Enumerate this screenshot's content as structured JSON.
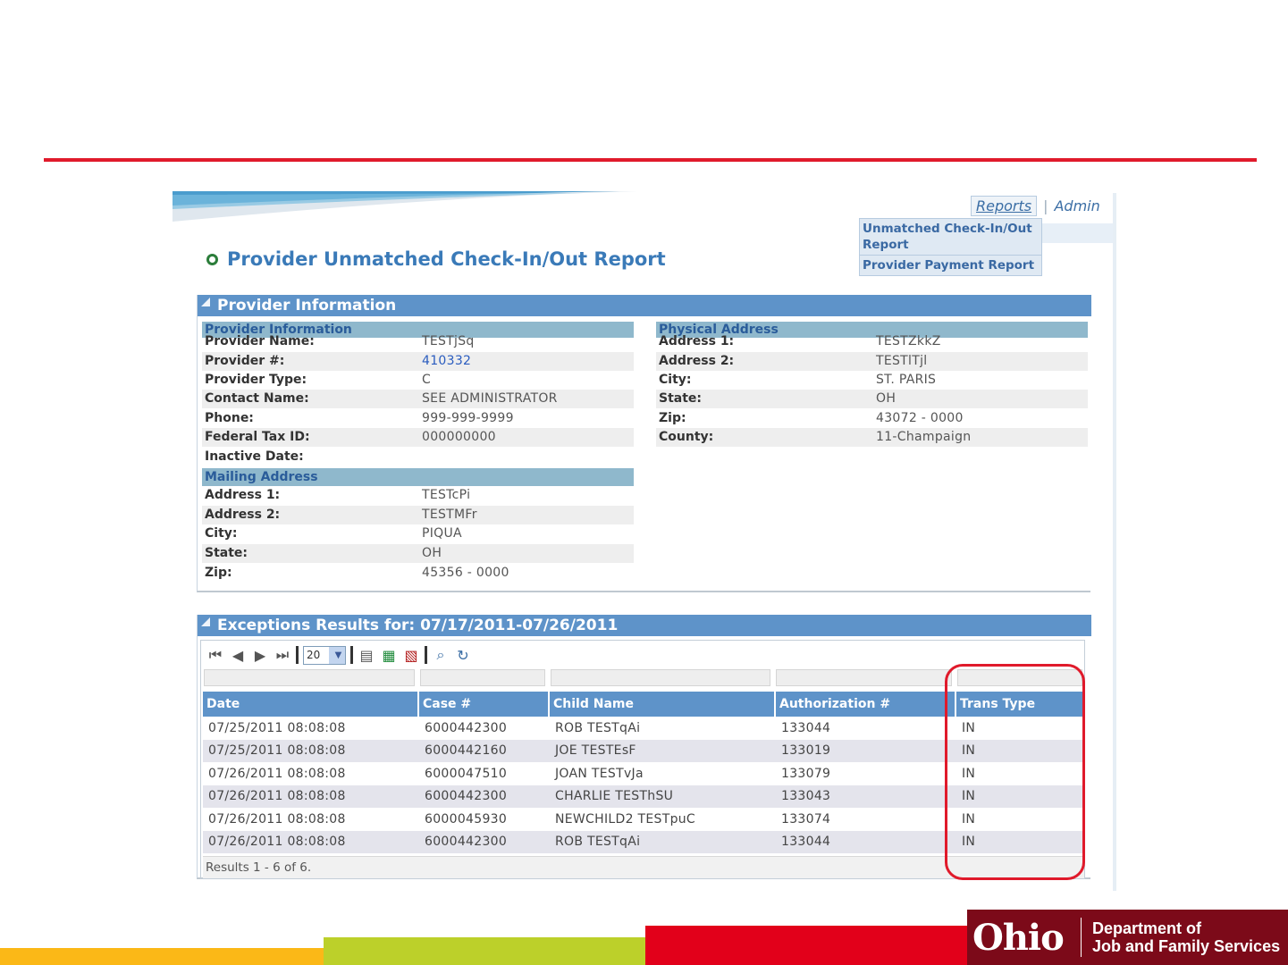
{
  "colors": {
    "accent_red": "#e01a2b",
    "header_blue": "#5e93c9",
    "title_blue": "#3a7ab8",
    "ohio_maroon": "#7c0a19"
  },
  "nav": {
    "reports": "Reports",
    "separator": "|",
    "admin": "Admin"
  },
  "reports_menu": {
    "item1": "Unmatched Check-In/Out Report",
    "item2": "Provider Payment Report"
  },
  "page_title": "Provider Unmatched Check-In/Out Report",
  "provider_panel": {
    "header": "Provider Information",
    "provider_info_header": "Provider Information",
    "provider_info": [
      {
        "label": "Provider Name:",
        "value": "TESTjSq"
      },
      {
        "label": "Provider #:",
        "value": "410332"
      },
      {
        "label": "Provider Type:",
        "value": "C"
      },
      {
        "label": "Contact Name:",
        "value": "SEE ADMINISTRATOR"
      },
      {
        "label": "Phone:",
        "value": "999-999-9999"
      },
      {
        "label": "Federal Tax ID:",
        "value": "000000000"
      },
      {
        "label": "Inactive Date:",
        "value": ""
      }
    ],
    "mailing_header": "Mailing Address",
    "mailing": [
      {
        "label": "Address 1:",
        "value": "TESTcPi"
      },
      {
        "label": "Address 2:",
        "value": "TESTMFr"
      },
      {
        "label": "City:",
        "value": "PIQUA"
      },
      {
        "label": "State:",
        "value": "OH"
      },
      {
        "label": "Zip:",
        "value": "45356 - 0000"
      }
    ],
    "physical_header": "Physical Address",
    "physical": [
      {
        "label": "Address 1:",
        "value": "TESTZkkZ"
      },
      {
        "label": "Address 2:",
        "value": "TESTlTjl"
      },
      {
        "label": "City:",
        "value": "ST. PARIS"
      },
      {
        "label": "State:",
        "value": "OH"
      },
      {
        "label": "Zip:",
        "value": "43072 - 0000"
      },
      {
        "label": "County:",
        "value": "11-Champaign"
      }
    ]
  },
  "exceptions": {
    "header": "Exceptions Results for: 07/17/2011-07/26/2011",
    "page_size": "20",
    "columns": [
      "Date",
      "Case #",
      "Child Name",
      "Authorization #",
      "Trans Type"
    ],
    "rows": [
      [
        "07/25/2011 08:08:08",
        "6000442300",
        "ROB TESTqAi",
        "133044",
        "IN"
      ],
      [
        "07/25/2011 08:08:08",
        "6000442160",
        "JOE TESTEsF",
        "133019",
        "IN"
      ],
      [
        "07/26/2011 08:08:08",
        "6000047510",
        "JOAN TESTvJa",
        "133079",
        "IN"
      ],
      [
        "07/26/2011 08:08:08",
        "6000442300",
        "CHARLIE TESThSU",
        "133043",
        "IN"
      ],
      [
        "07/26/2011 08:08:08",
        "6000045930",
        "NEWCHILD2 TESTpuC",
        "133074",
        "IN"
      ],
      [
        "07/26/2011 08:08:08",
        "6000442300",
        "ROB TESTqAi",
        "133044",
        "IN"
      ]
    ],
    "footer": "Results 1 - 6 of 6."
  },
  "branding": {
    "ohio": "Ohio",
    "dept_line1": "Department of",
    "dept_line2": "Job and Family Services"
  }
}
